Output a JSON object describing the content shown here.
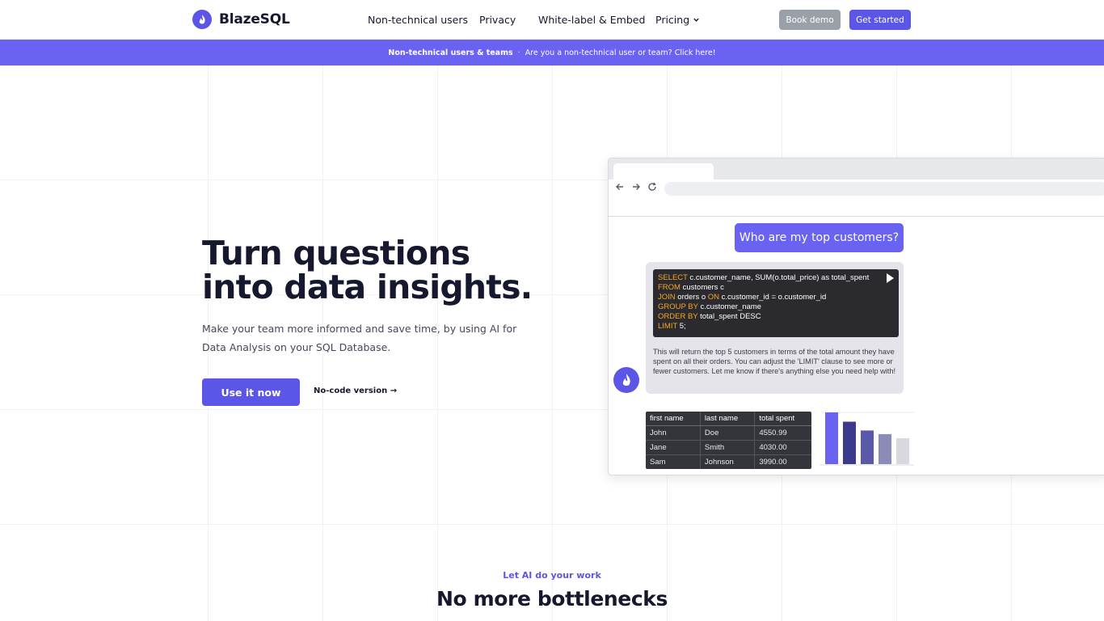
{
  "brand": {
    "name": "BlazeSQL",
    "accent": "#5b55e8"
  },
  "nav": {
    "links": [
      "Non-technical users",
      "Privacy",
      "White-label & Embed",
      "Pricing"
    ],
    "book_demo": "Book demo",
    "get_started": "Get started"
  },
  "banner": {
    "bold": "Non-technical users & teams",
    "separator": "·",
    "text": "Are you a non-technical user or team? Click here!"
  },
  "hero": {
    "title": "Turn questions into data insights.",
    "subtitle": "Make your team more informed and save time, by using AI for Data Analysis on your SQL Database.",
    "cta": "Use it now",
    "secondary": "No-code version →"
  },
  "mockup": {
    "question": "Who are my top customers?",
    "sql": [
      {
        "kw": "SELECT",
        "rest": " c.customer_name, SUM(o.total_price) as total_spent"
      },
      {
        "kw": "FROM",
        "rest": " customers c"
      },
      {
        "kw": "JOIN",
        "rest": " orders o ",
        "kw2": "ON",
        "rest2": " c.customer_id = o.customer_id"
      },
      {
        "kw": "GROUP BY",
        "rest": " c.customer_name"
      },
      {
        "kw": "ORDER BY",
        "rest": " total_spent DESC"
      },
      {
        "kw": "LIMIT",
        "rest": " 5;"
      }
    ],
    "answer": "This will return the top 5 customers in terms of the total amount they have spent on all their orders. You can adjust the 'LIMIT' clause to see more or fewer customers. Let me know if there's anything else you need help with!",
    "table": {
      "headers": [
        "first name",
        "last name",
        "total spent"
      ],
      "rows": [
        [
          "John",
          "Doe",
          "4550.99"
        ],
        [
          "Jane",
          "Smith",
          "4030.00"
        ],
        [
          "Sam",
          "Johnson",
          "3990.00"
        ]
      ]
    },
    "bar_fills": [
      1.0,
      0.82,
      0.65,
      0.58,
      0.5
    ],
    "bar_colors": [
      "#6a63f2",
      "#3b3a8c",
      "#5a58a8",
      "#8c8bb8",
      "#d8d8de"
    ]
  },
  "section": {
    "tag": "Let AI do your work",
    "title": "No more bottlenecks"
  }
}
